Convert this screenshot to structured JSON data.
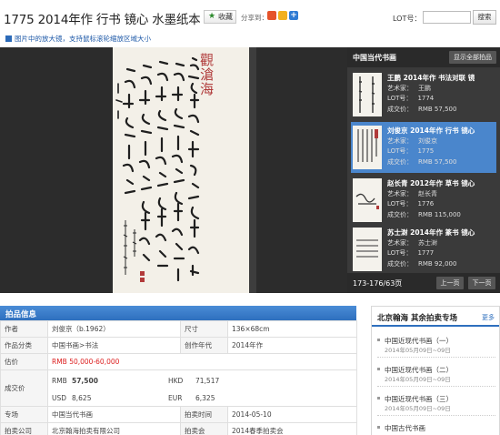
{
  "header": {
    "title": "1775 2014年作 行书 镜心 水墨纸本",
    "fav_label": "收藏",
    "share_label": "分享到：",
    "share_more": "+",
    "lot_search_label": "LOT号：",
    "lot_search_value": "",
    "search_label": "搜索"
  },
  "zoom_tip": "图片中的放大镜，支持鼠标滚轮缩放区域大小",
  "viewer": {
    "calligraphy_title": "觀滄海",
    "artwork_alt": "calligraphy scroll"
  },
  "thumbs": {
    "panel_title": "中国当代书画",
    "show_all_label": "显示全部拍品",
    "items": [
      {
        "title": "王鹏 2014年作 书法对联 镜",
        "artist_label": "艺术家：",
        "artist": "王鹏",
        "lot_label": "LOT号：",
        "lot": "1774",
        "price_label": "成交价：",
        "price": "RMB 57,500",
        "active": false
      },
      {
        "title": "刘俊京 2014年作 行书 镜心",
        "artist_label": "艺术家：",
        "artist": "刘俊京",
        "lot_label": "LOT号：",
        "lot": "1775",
        "price_label": "成交价：",
        "price": "RMB 57,500",
        "active": true
      },
      {
        "title": "赵长青 2012年作 草书 镜心",
        "artist_label": "艺术家：",
        "artist": "赵长青",
        "lot_label": "LOT号：",
        "lot": "1776",
        "price_label": "成交价：",
        "price": "RMB 115,000",
        "active": false
      },
      {
        "title": "苏士澍 2014年作 篆书 镜心",
        "artist_label": "艺术家：",
        "artist": "苏士澍",
        "lot_label": "LOT号：",
        "lot": "1777",
        "price_label": "成交价：",
        "price": "RMB 92,000",
        "active": false
      }
    ],
    "page_info": "173-176/63页",
    "prev_label": "上一页",
    "next_label": "下一页"
  },
  "info": {
    "title": "拍品信息",
    "author_label": "作者",
    "author": "刘俊京（b.1962）",
    "size_label": "尺寸",
    "size": "136×68cm",
    "category_label": "作品分类",
    "category": "中国书画>书法",
    "year_label": "创作年代",
    "year": "2014年作",
    "estimate_label": "估价",
    "estimate": "RMB   50,000-60,000",
    "deal_label": "成交价",
    "deal": {
      "rmb_cur": "RMB",
      "rmb": "57,500",
      "hkd_cur": "HKD",
      "hkd": "71,517",
      "usd_cur": "USD",
      "usd": "8,625",
      "eur_cur": "EUR",
      "eur": "6,325"
    },
    "session_label": "专场",
    "session": "中国当代书画",
    "auction_time_label": "拍卖时间",
    "auction_time": "2014-05-10",
    "company_label": "拍卖公司",
    "company": "北京翰海拍卖有限公司",
    "sale_label": "拍卖会",
    "sale": "2014春季拍卖会"
  },
  "sidebar": {
    "title": "北京翰海  其余拍卖专场",
    "more": "更多",
    "items": [
      {
        "name": "中国近现代书画（一）",
        "date": "2014年05月09日~09日"
      },
      {
        "name": "中国近现代书画（二）",
        "date": "2014年05月09日~09日"
      },
      {
        "name": "中国近现代书画（三）",
        "date": "2014年05月09日~09日"
      },
      {
        "name": "中国古代书画",
        "date": ""
      }
    ]
  }
}
